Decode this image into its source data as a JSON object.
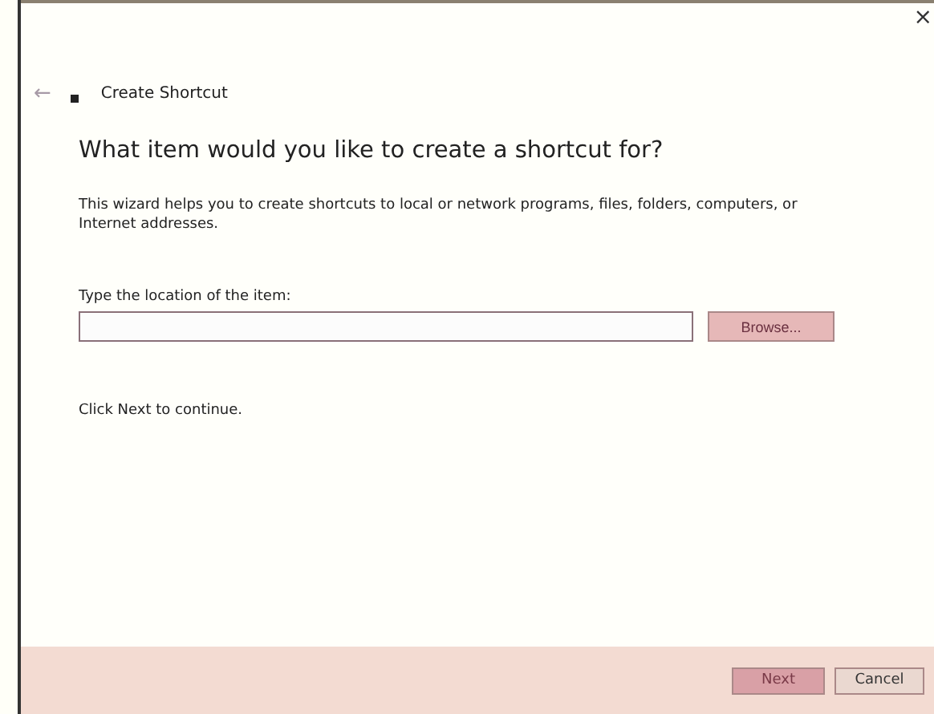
{
  "window": {
    "close_glyph": "×"
  },
  "header": {
    "back_glyph": "←",
    "title": "Create Shortcut"
  },
  "heading": "What item would you like to create a shortcut for?",
  "description": "This wizard helps you to create shortcuts to local or network programs, files, folders, computers, or Internet addresses.",
  "location": {
    "label": "Type the location of the item:",
    "browse": "Browse..."
  },
  "hint": "Click Next to continue.",
  "buttons": [
    {
      "label": "Next",
      "disabled": true
    },
    {
      "label": "Cancel",
      "disabled": false
    }
  ]
}
